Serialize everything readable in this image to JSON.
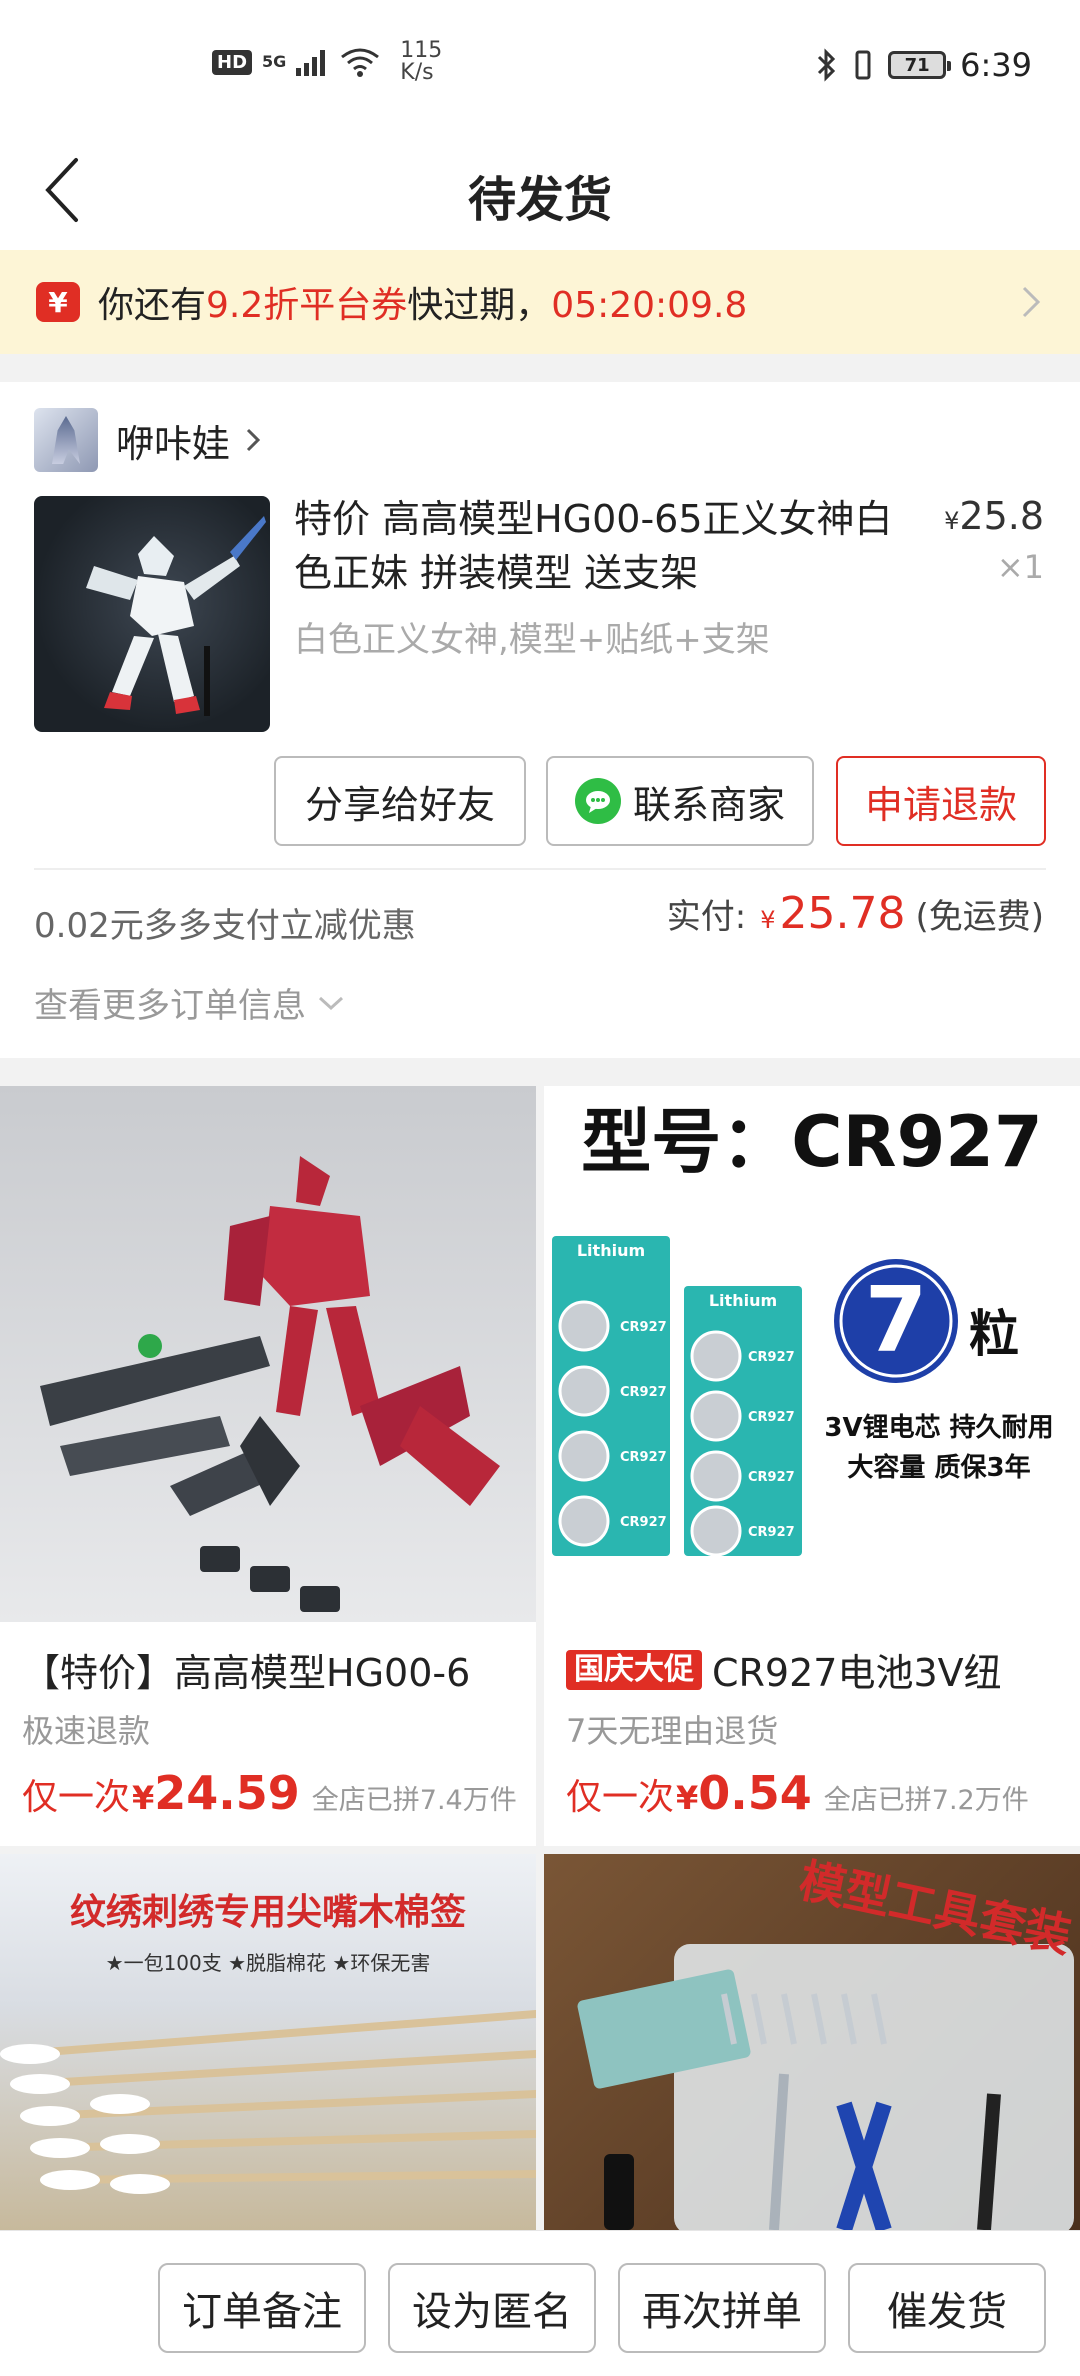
{
  "status_bar": {
    "hd": "HD",
    "signal": "5G",
    "speed_value": "115",
    "speed_unit": "K/s",
    "battery": "71",
    "time": "6:39"
  },
  "header": {
    "title": "待发货"
  },
  "coupon": {
    "icon_text": "¥",
    "text_before": "你还有",
    "highlight": "9.2折平台券",
    "text_after": "快过期，",
    "countdown": "05:20:09.8"
  },
  "store": {
    "name": "咿咔娃"
  },
  "order": {
    "title": "特价 高高模型HG00-65正义女神白色正妹 拼装模型 送支架",
    "sku": "白色正义女神,模型+贴纸+支架",
    "price_symbol": "¥",
    "price": "25.8",
    "quantity": "×1",
    "buttons": {
      "share": "分享给好友",
      "contact": "联系商家",
      "refund": "申请退款"
    },
    "discount_note": "0.02元多多支付立减优惠",
    "paid_label": "实付:",
    "paid_symbol": "¥",
    "paid_amount": "25.78",
    "paid_note": "(免运费)",
    "more_info": "查看更多订单信息"
  },
  "recommendations": [
    {
      "title": "【特价】高高模型HG00-6",
      "tag": "",
      "sub": "极速退款",
      "once": "仅一次",
      "symbol": "¥",
      "price": "24.59",
      "sold": "全店已拼7.4万件"
    },
    {
      "title": "CR927电池3V纽",
      "tag": "国庆大促",
      "sub": "7天无理由退货",
      "once": "仅一次",
      "symbol": "¥",
      "price": "0.54",
      "sold": "全店已拼7.2万件",
      "image_text": {
        "model": "型号：CR927",
        "count": "7",
        "unit": "粒",
        "line1": "3V锂电芯 持久耐用",
        "line2": "大容量 质保3年",
        "cell_brand": "Lithium",
        "cell_model": "CR927"
      }
    },
    {
      "image_text": {
        "headline": "纹绣刺绣专用尖嘴木棉签",
        "features": "★一包100支  ★脱脂棉花  ★环保无害"
      }
    },
    {
      "image_text": {
        "headline": "模型工具套装"
      }
    }
  ],
  "bottom_bar": {
    "note": "订单备注",
    "anonymous": "设为匿名",
    "reorder": "再次拼单",
    "urge": "催发货"
  }
}
